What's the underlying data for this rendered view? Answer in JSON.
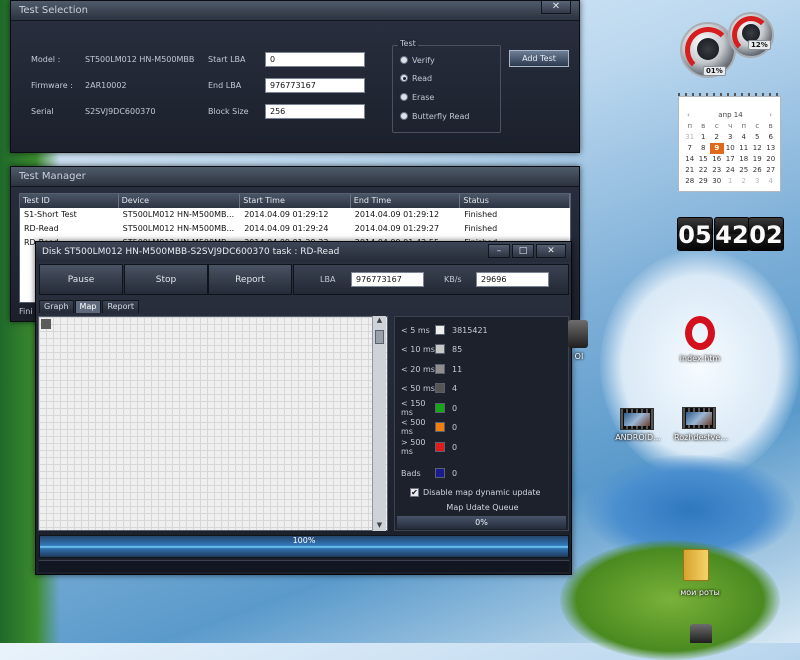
{
  "test_selection": {
    "title": "Test Selection",
    "close_label": "✕",
    "model_label": "Model :",
    "model_value": "ST500LM012 HN-M500MBB",
    "firmware_label": "Firmware :",
    "firmware_value": "2AR10002",
    "serial_label": "Serial",
    "serial_value": "S2SVJ9DC600370",
    "start_lba_label": "Start LBA",
    "start_lba_value": "0",
    "end_lba_label": "End LBA",
    "end_lba_value": "976773167",
    "block_size_label": "Block Size",
    "block_size_value": "256",
    "test_group_label": "Test",
    "test_options": [
      "Verify",
      "Read",
      "Erase",
      "Butterfly Read"
    ],
    "selected_test": "Read",
    "add_test_label": "Add Test"
  },
  "test_manager": {
    "title": "Test Manager",
    "columns": [
      "Test ID",
      "Device",
      "Start Time",
      "End Time",
      "Status"
    ],
    "rows": [
      [
        "S1-Short Test",
        "ST500LM012 HN-M500MB...",
        "2014.04.09 01:29:12",
        "2014.04.09 01:29:12",
        "Finished"
      ],
      [
        "RD-Read",
        "ST500LM012 HN-M500MB...",
        "2014.04.09 01:29:24",
        "2014.04.09 01:29:27",
        "Finished"
      ],
      [
        "RD-Read",
        "ST500LM012 HN-M500MB...",
        "2014.04.09 01:29:33",
        "2014.04.09 01:42:55",
        "Finished"
      ]
    ],
    "status_text": "Fini"
  },
  "disk_window": {
    "title": "Disk ST500LM012 HN-M500MBB-S2SVJ9DC600370   task : RD-Read",
    "minimize_label": "–",
    "maximize_label": "□",
    "close_label": "✕",
    "pause_label": "Pause",
    "stop_label": "Stop",
    "report_label": "Report",
    "lba_label": "LBA",
    "lba_value": "976773167",
    "kbs_label": "KB/s",
    "kbs_value": "29696",
    "tabs": [
      "Graph",
      "Map",
      "Report"
    ],
    "active_tab": "Map",
    "legend": [
      {
        "label": "< 5 ms",
        "color": "#eeeeee",
        "count": "3815421"
      },
      {
        "label": "< 10 ms",
        "color": "#c8c8c8",
        "count": "85"
      },
      {
        "label": "< 20 ms",
        "color": "#8f8f8f",
        "count": "11"
      },
      {
        "label": "< 50 ms",
        "color": "#555555",
        "count": "4"
      },
      {
        "label": "< 150 ms",
        "color": "#14a614",
        "count": "0"
      },
      {
        "label": "< 500 ms",
        "color": "#f07f0e",
        "count": "0"
      },
      {
        "label": "> 500 ms",
        "color": "#e01b1b",
        "count": "0"
      }
    ],
    "bads": {
      "label": "Bads",
      "color": "#1b1b8f",
      "count": "0"
    },
    "disable_map_label": "Disable map dynamic update",
    "disable_map_checked": true,
    "queue_label": "Map Udate Queue",
    "queue_percent": "0%",
    "progress_percent_text": "100%",
    "progress_fraction": 1.0
  },
  "gadgets": {
    "gauge_left_label": "01%",
    "gauge_right_label": "12%",
    "calendar_month": "апр 14",
    "calendar_weekdays": [
      "п",
      "в",
      "с",
      "ч",
      "п",
      "с",
      "в"
    ],
    "calendar_days": [
      "31",
      "1",
      "2",
      "3",
      "4",
      "5",
      "6",
      "7",
      "8",
      "9",
      "10",
      "11",
      "12",
      "13",
      "14",
      "15",
      "16",
      "17",
      "18",
      "19",
      "20",
      "21",
      "22",
      "23",
      "24",
      "25",
      "26",
      "27",
      "28",
      "29",
      "30",
      "1",
      "2",
      "3",
      "4"
    ],
    "calendar_today": "9",
    "clock_hours": "05",
    "clock_minutes": "42",
    "clock_seconds": "02"
  },
  "desktop_icons": {
    "opera_label": "index.htm",
    "video1_label": "ANDROID...",
    "video2_label": "Rozhdestve...",
    "folder_label": "мои роты",
    "partial_label": "OI"
  }
}
